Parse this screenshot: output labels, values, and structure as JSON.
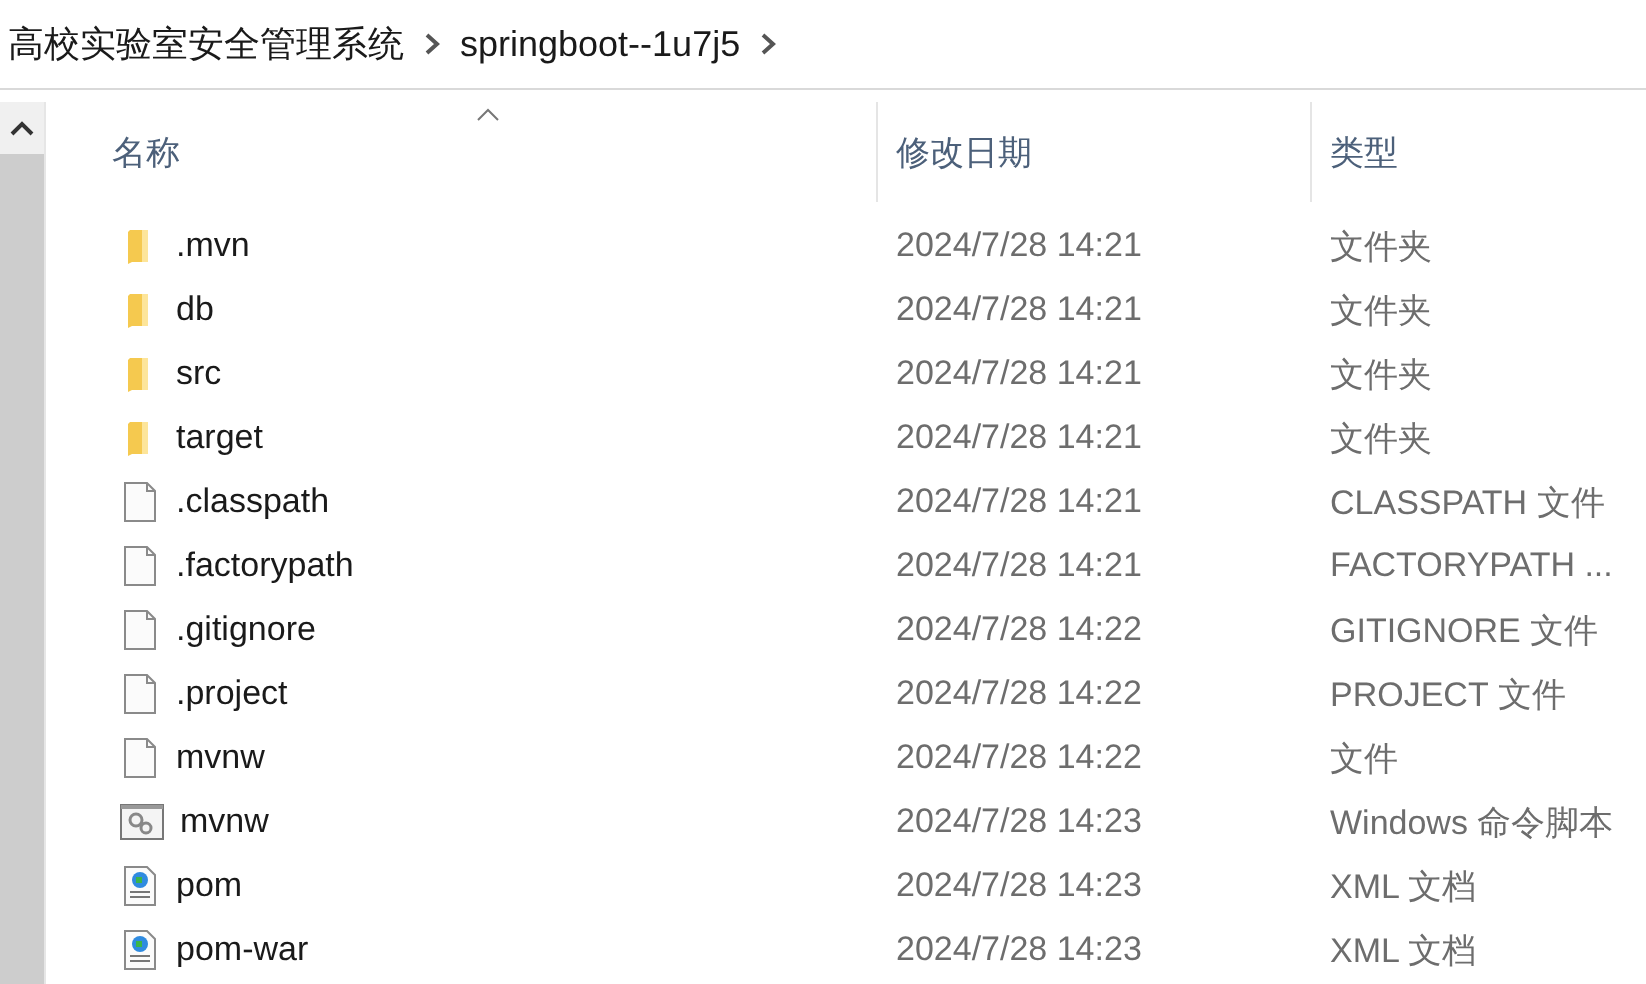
{
  "breadcrumb": [
    {
      "label": "高校实验室安全管理系统"
    },
    {
      "label": "springboot--1u7j5"
    }
  ],
  "columns": [
    {
      "label": "名称",
      "sorted": true
    },
    {
      "label": "修改日期",
      "sorted": false
    },
    {
      "label": "类型",
      "sorted": false
    }
  ],
  "files": [
    {
      "kind": "folder",
      "name": ".mvn",
      "modified": "2024/7/28 14:21",
      "type": "文件夹"
    },
    {
      "kind": "folder",
      "name": "db",
      "modified": "2024/7/28 14:21",
      "type": "文件夹"
    },
    {
      "kind": "folder",
      "name": "src",
      "modified": "2024/7/28 14:21",
      "type": "文件夹"
    },
    {
      "kind": "folder",
      "name": "target",
      "modified": "2024/7/28 14:21",
      "type": "文件夹"
    },
    {
      "kind": "file",
      "name": ".classpath",
      "modified": "2024/7/28 14:21",
      "type": "CLASSPATH 文件"
    },
    {
      "kind": "file",
      "name": ".factorypath",
      "modified": "2024/7/28 14:21",
      "type": "FACTORYPATH ..."
    },
    {
      "kind": "file",
      "name": ".gitignore",
      "modified": "2024/7/28 14:22",
      "type": "GITIGNORE 文件"
    },
    {
      "kind": "file",
      "name": ".project",
      "modified": "2024/7/28 14:22",
      "type": "PROJECT 文件"
    },
    {
      "kind": "file",
      "name": "mvnw",
      "modified": "2024/7/28 14:22",
      "type": "文件"
    },
    {
      "kind": "script",
      "name": "mvnw",
      "modified": "2024/7/28 14:23",
      "type": "Windows 命令脚本"
    },
    {
      "kind": "xml",
      "name": "pom",
      "modified": "2024/7/28 14:23",
      "type": "XML 文档"
    },
    {
      "kind": "xml",
      "name": "pom-war",
      "modified": "2024/7/28 14:23",
      "type": "XML 文档"
    }
  ]
}
